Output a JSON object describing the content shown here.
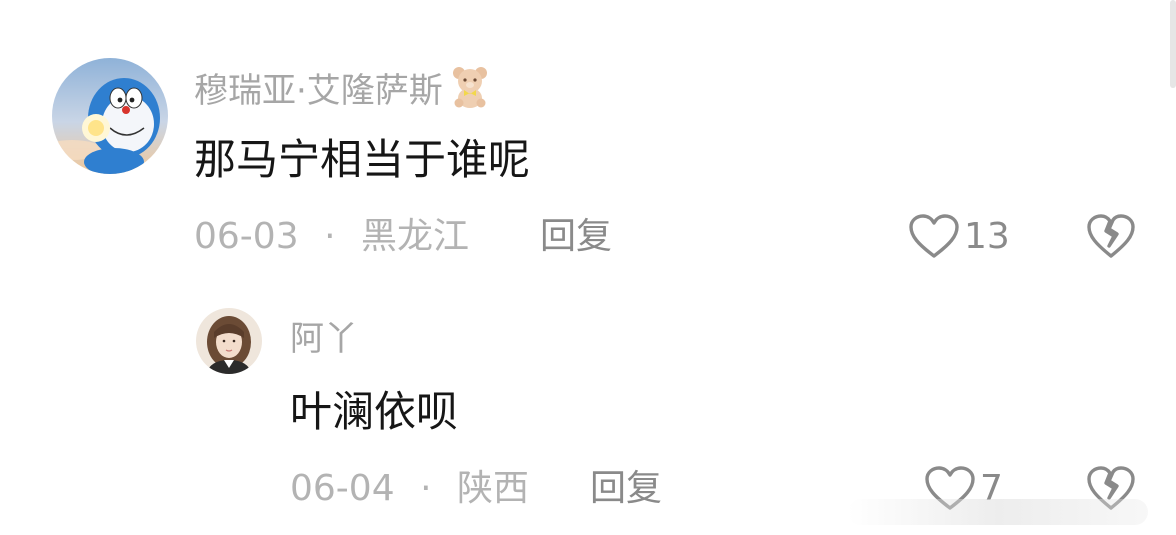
{
  "comments": [
    {
      "username": "穆瑞亚·艾隆萨斯",
      "badge_icon": "teddy-bear-icon",
      "text": "那马宁相当于谁呢",
      "date": "06-03",
      "location": "黑龙江",
      "separator": "·",
      "reply_label": "回复",
      "likes": "13"
    },
    {
      "username": "阿丫",
      "text": "叶澜依呗",
      "date": "06-04",
      "location": "陕西",
      "separator": "·",
      "reply_label": "回复",
      "likes": "7"
    }
  ],
  "colors": {
    "username": "#a6a6a6",
    "content": "#161616",
    "meta": "#b3b3b3",
    "action": "#8a8a8a"
  }
}
